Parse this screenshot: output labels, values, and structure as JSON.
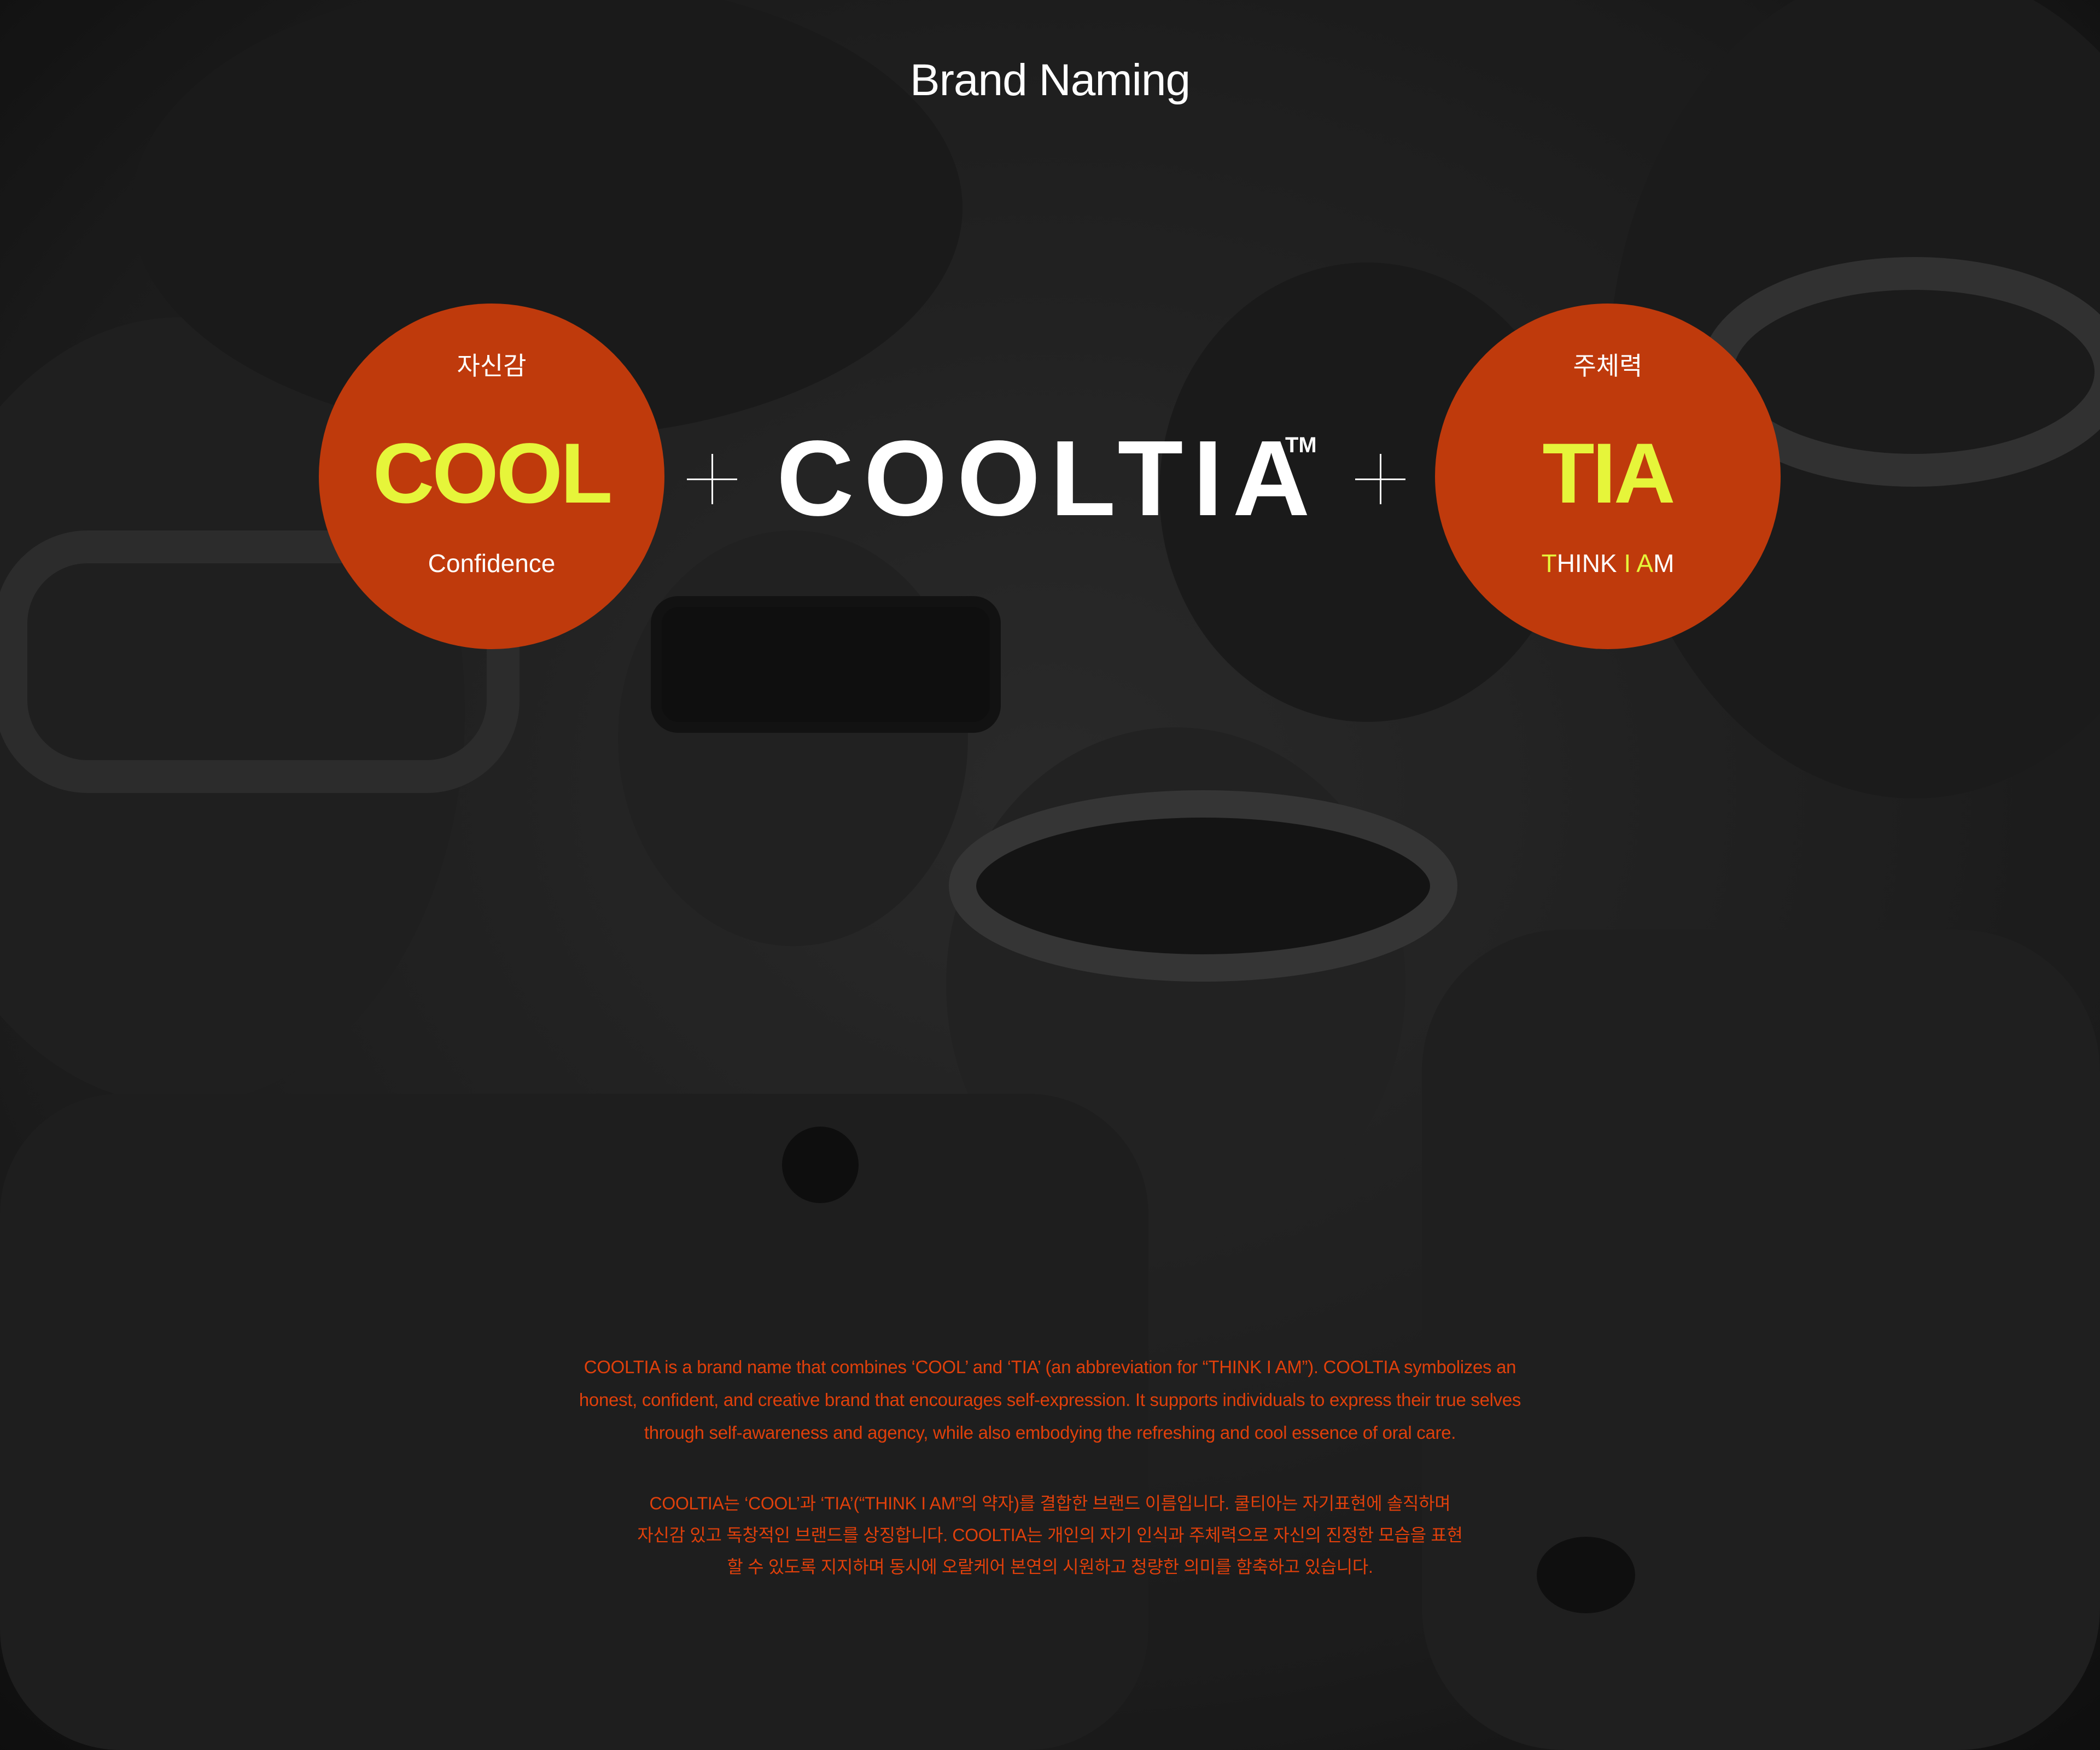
{
  "page": {
    "title": "Brand Naming"
  },
  "left_circle": {
    "korean": "자신감",
    "word": "COOL",
    "meaning": "Confidence"
  },
  "right_circle": {
    "korean": "주체력",
    "word": "TIA",
    "meaning_parts": [
      "T",
      "HINK ",
      "I",
      " ",
      "A",
      "M"
    ]
  },
  "logo": {
    "wordmark": "COOLTIA",
    "trademark": "TM"
  },
  "description_en": [
    "COOLTIA is a brand name that combines ‘COOL’ and ‘TIA’ (an abbreviation for “THINK I AM”). COOLTIA symbolizes an",
    "honest, confident, and creative brand that encourages self-expression. It supports individuals to express their true selves",
    "through self-awareness and agency, while also embodying the refreshing and cool essence of oral care."
  ],
  "description_kr": [
    "COOLTIA는 ‘COOL’과 ‘TIA’(“THINK I AM”의 약자)를 결합한 브랜드 이름입니다. 쿨티아는 자기표현에 솔직하며",
    "자신감 있고 독창적인 브랜드를 상징합니다. COOLTIA는 개인의 자기 인식과 주체력으로 자신의 진정한 모습을 표현",
    "할 수 있도록 지지하며 동시에 오랄케어 본연의 시원하고 청량한 의미를 함축하고 있습니다."
  ],
  "colors": {
    "background": "#1f1f1f",
    "circle": "#bf3a0c",
    "accent": "#e6f53a",
    "text_orange": "#e0400b",
    "white": "#ffffff"
  }
}
